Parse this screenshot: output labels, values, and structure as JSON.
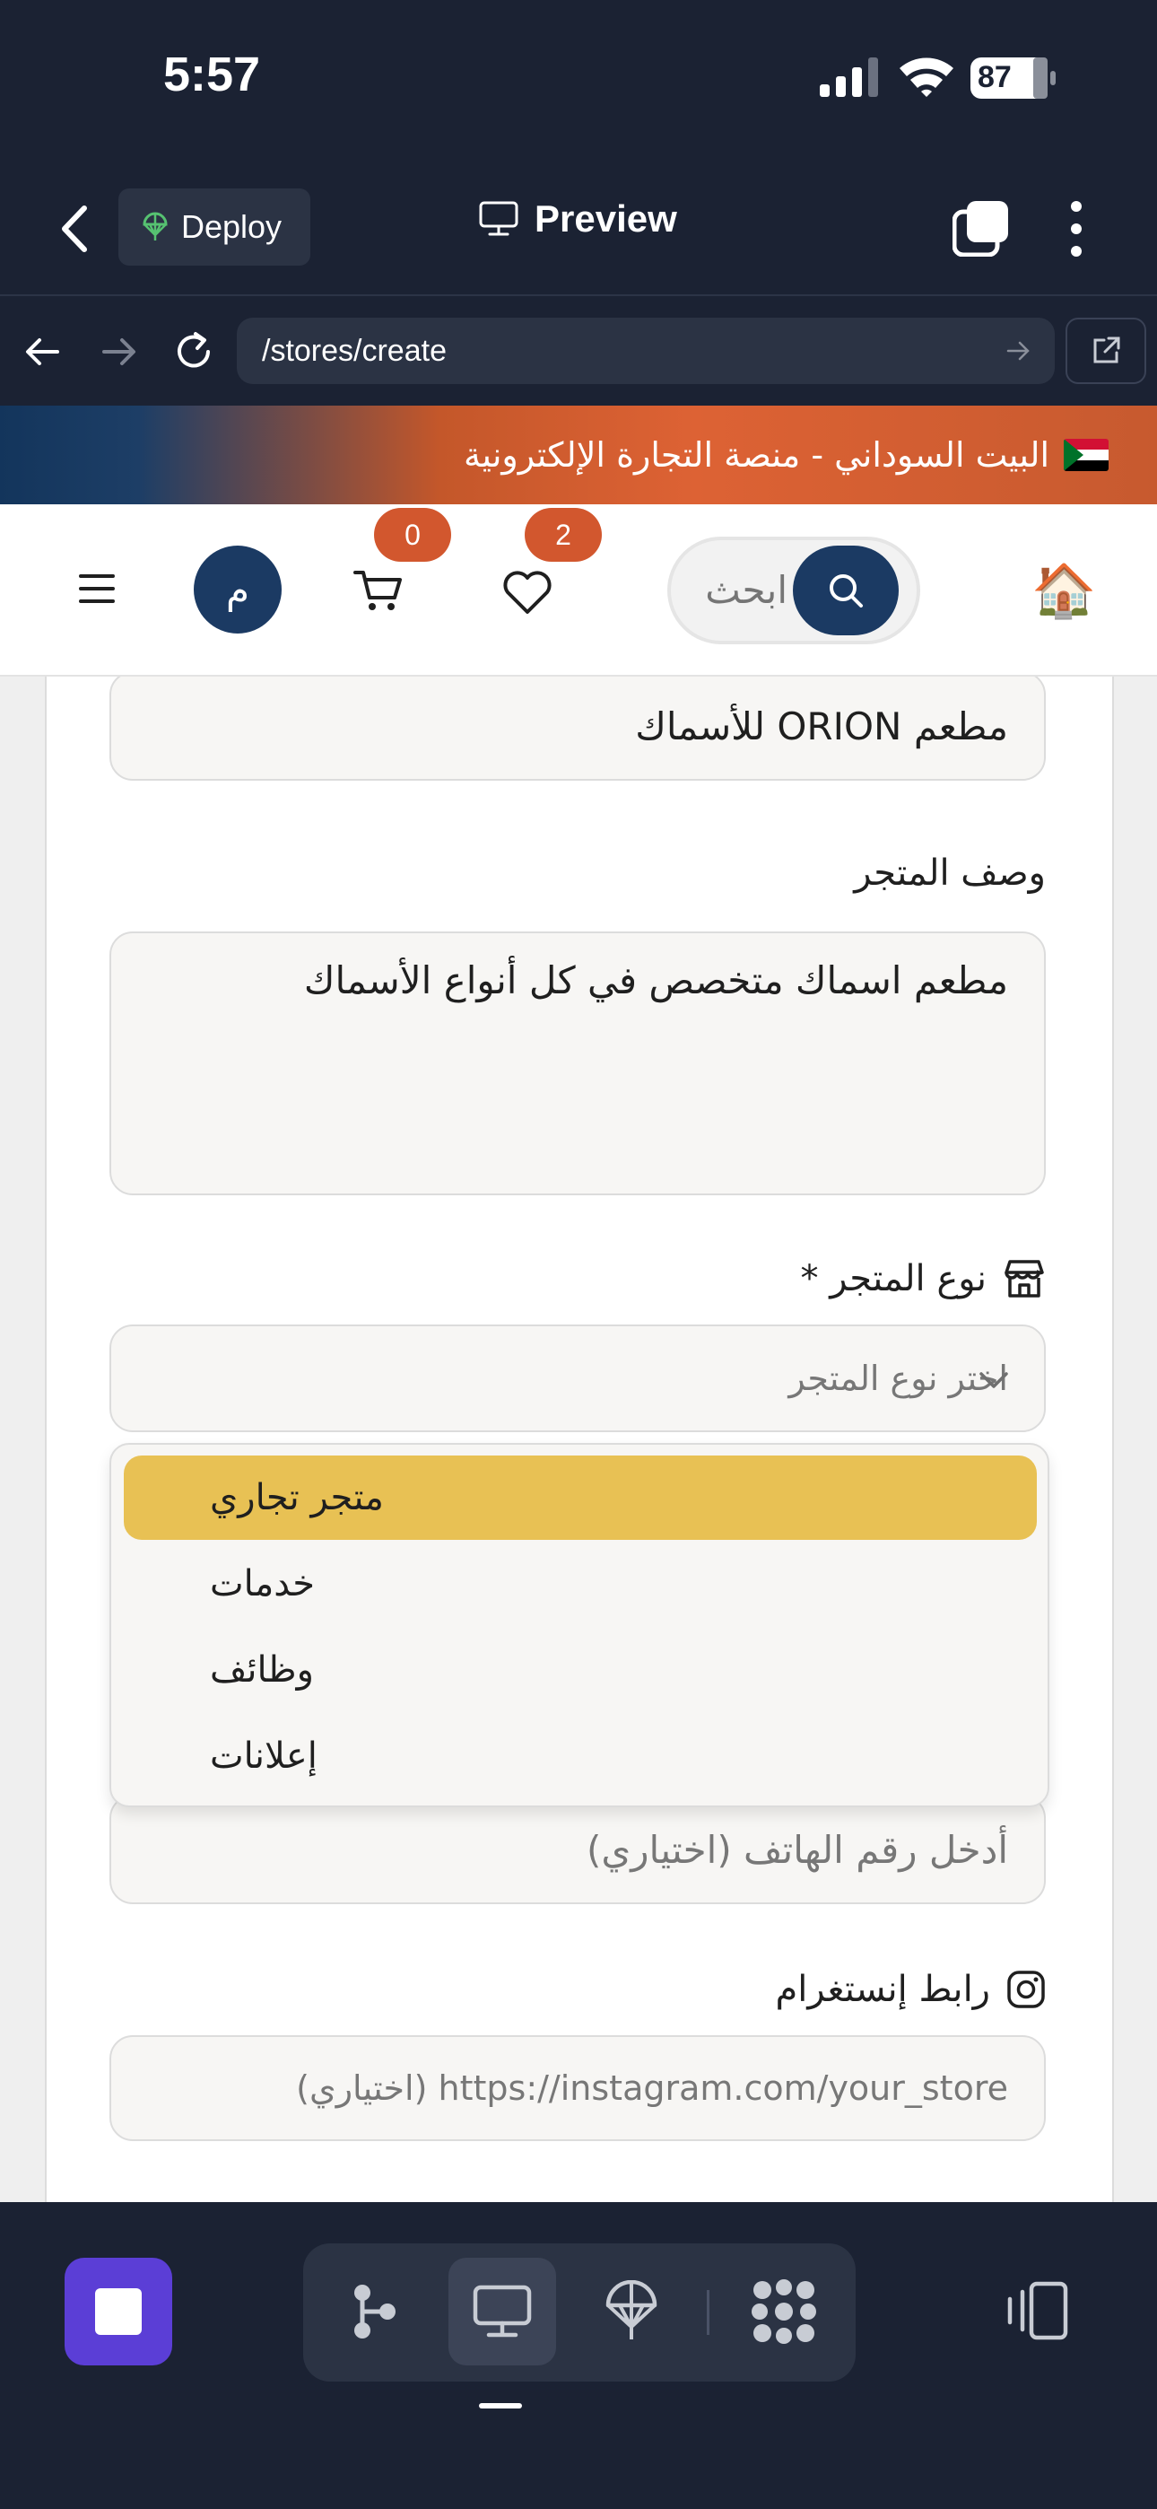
{
  "status_bar": {
    "time": "5:57",
    "battery": "87"
  },
  "app_toolbar": {
    "deploy_label": "Deploy",
    "preview_label": "Preview"
  },
  "browser": {
    "url": "/stores/create"
  },
  "site": {
    "banner_text": "البيت السوداني - منصة التجارة الإلكترونية",
    "search_placeholder": "ابحث",
    "cart_count": "0",
    "wishlist_count": "2",
    "avatar_initial": "م"
  },
  "form": {
    "store_name_value": "مطعم ORION للأسماك",
    "description_label": "وصف المتجر",
    "description_value": "مطعم اسماك متخصص في كل أنواع الأسماك",
    "store_type_label": "نوع المتجر *",
    "store_type_placeholder": "اختر نوع المتجر",
    "store_type_options": [
      "متجر تجاري",
      "خدمات",
      "وظائف",
      "إعلانات"
    ],
    "phone_placeholder": "أدخل رقم الهاتف (اختياري)",
    "instagram_label": "رابط إنستغرام",
    "instagram_placeholder": "https://instagram.com/your_store (اختياري)"
  },
  "colors": {
    "accent_navy": "#1b3a63",
    "badge_orange": "#d2572e",
    "selected_option": "#e8c154",
    "stop_button": "#5b3ed6"
  }
}
